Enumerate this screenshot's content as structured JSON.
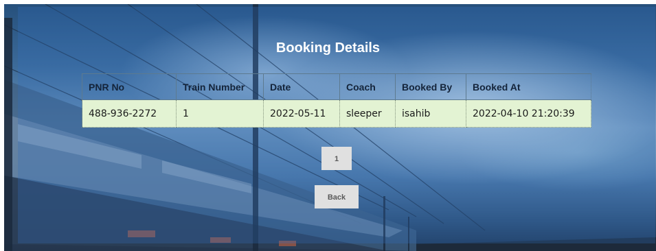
{
  "page": {
    "heading": "Booking Details"
  },
  "table": {
    "headers": [
      "PNR No",
      "Train Number",
      "Date",
      "Coach",
      "Booked By",
      "Booked At"
    ],
    "rows": [
      [
        "488-936-2272",
        "1",
        "2022-05-11",
        "sleeper",
        "isahib",
        "2022-04-10 21:20:39"
      ]
    ]
  },
  "pagination": {
    "current_page": "1"
  },
  "actions": {
    "back_label": "Back"
  },
  "colors": {
    "panel_tint": "#326ebe",
    "row_background": "#e3f3d3",
    "button_background": "#e0e0e0",
    "heading_text": "#ffffff"
  }
}
